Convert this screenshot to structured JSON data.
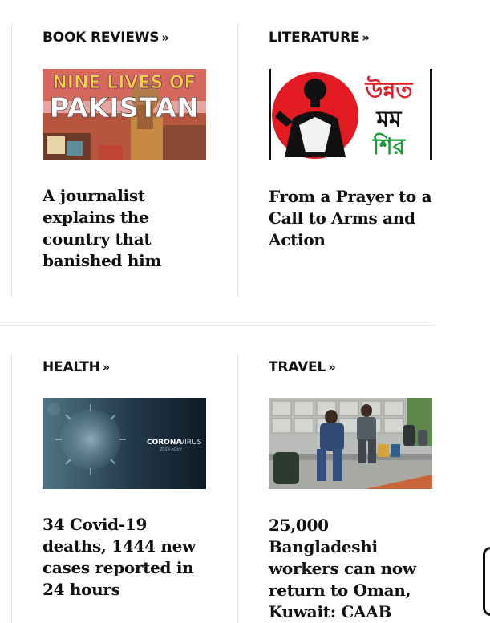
{
  "cards": [
    {
      "section": "BOOK REVIEWS",
      "headline": "A journalist explains the country that banished him",
      "image_text": "NINE LIVES OF PAKISTAN"
    },
    {
      "section": "LITERATURE",
      "headline": "From a Prayer to a Call to Arms and Action",
      "image_text": [
        "উন্নত",
        "মম",
        "শির"
      ]
    },
    {
      "section": "HEALTH",
      "headline": "34 Covid-19 deaths, 1444 new cases reported in 24 hours",
      "image_text": [
        "CORONA",
        "VIRUS",
        "2019-nCoV"
      ]
    },
    {
      "section": "TRAVEL",
      "headline": "25,000 Bangladeshi workers can now return to Oman, Kuwait: CAAB"
    }
  ],
  "icons": {
    "section_chevron": "double-chevron-right-icon"
  },
  "colors": {
    "text": "#111111",
    "divider": "#e6e6e6",
    "literature_red": "#e21b23",
    "literature_green": "#1a9a3a"
  }
}
